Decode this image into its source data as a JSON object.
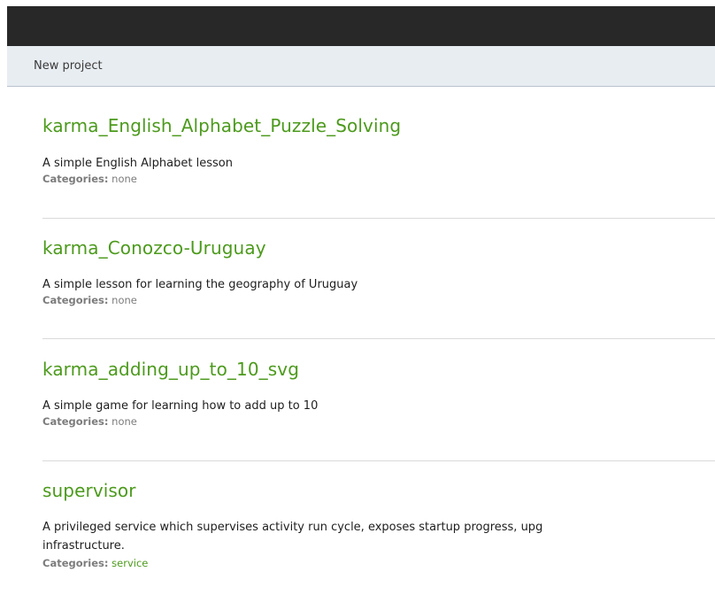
{
  "toolbar": {
    "new_project_label": "New project"
  },
  "projects": [
    {
      "name": "karma_English_Alphabet_Puzzle_Solving",
      "description": "A simple English Alphabet lesson",
      "categories_label": "Categories:",
      "categories": "none"
    },
    {
      "name": "karma_Conozco-Uruguay",
      "description": "A simple lesson for learning the geography of Uruguay",
      "categories_label": "Categories:",
      "categories": "none"
    },
    {
      "name": "karma_adding_up_to_10_svg",
      "description": "A simple game for learning how to add up to 10",
      "categories_label": "Categories:",
      "categories": "none"
    },
    {
      "name": "supervisor",
      "description_line1": "A privileged service which supervises activity run cycle, exposes startup progress, upg",
      "description_line2": "infrastructure.",
      "categories_label": "Categories:",
      "categories": "service"
    }
  ],
  "colors": {
    "topbar": "#282828",
    "subbar": "#e8edf2",
    "link_green": "#4c9a1c"
  }
}
